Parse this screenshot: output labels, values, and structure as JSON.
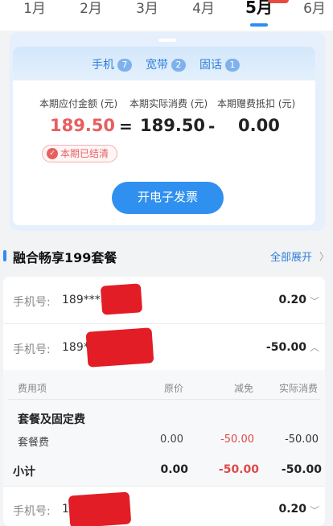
{
  "months": [
    {
      "label": "1月",
      "active": false
    },
    {
      "label": "2月",
      "active": false
    },
    {
      "label": "3月",
      "active": false
    },
    {
      "label": "4月",
      "active": false
    },
    {
      "label": "5月",
      "active": true
    },
    {
      "label": "6月",
      "active": false
    }
  ],
  "bill": {
    "pills": [
      {
        "label": "手机",
        "count": "7"
      },
      {
        "label": "宽带",
        "count": "2"
      },
      {
        "label": "固话",
        "count": "1"
      }
    ],
    "payable_label": "本期应付金额 (元)",
    "actual_label": "本期实际消费 (元)",
    "gift_label": "本期赠费抵扣 (元)",
    "payable_value": "189.50",
    "equals": "=",
    "actual_value": "189.50",
    "minus": "-",
    "gift_value": "0.00",
    "settled_label": "本期已结清",
    "invoice_button": "开电子发票"
  },
  "package": {
    "title": "融合畅享199套餐",
    "expand_all": "全部展开"
  },
  "lines": [
    {
      "label": "手机号:",
      "number": "189***",
      "amount": "0.20"
    },
    {
      "label": "手机号:",
      "number": "189*",
      "amount": "-50.00"
    },
    {
      "label": "手机号:",
      "number": "1",
      "amount": "0.20"
    }
  ],
  "detail": {
    "headers": [
      "费用项",
      "原价",
      "减免",
      "实际消费"
    ],
    "group_title": "套餐及固定费",
    "item": {
      "name": "套餐费",
      "original": "0.00",
      "discount": "-50.00",
      "actual": "-50.00"
    },
    "subtotal": {
      "label": "小计",
      "original": "0.00",
      "discount": "-50.00",
      "actual": "-50.00"
    }
  },
  "colors": {
    "accent": "#2f8cf0",
    "red": "#e04848",
    "redact": "#e21d25"
  }
}
